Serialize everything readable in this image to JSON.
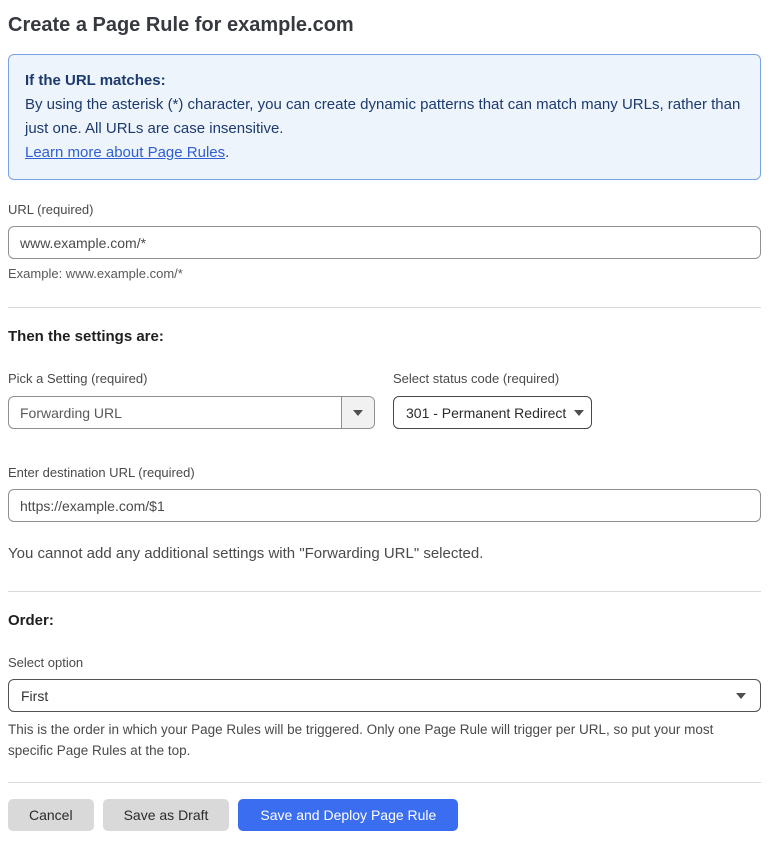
{
  "page_title": "Create a Page Rule for example.com",
  "info_box": {
    "heading": "If the URL matches:",
    "body": "By using the asterisk (*) character, you can create dynamic patterns that can match many URLs, rather than just one. All URLs are case insensitive.",
    "link_text": "Learn more about Page Rules",
    "link_suffix": "."
  },
  "url_field": {
    "label": "URL (required)",
    "value": "www.example.com/*",
    "help": "Example: www.example.com/*"
  },
  "settings_section": {
    "heading": "Then the settings are:",
    "setting_select": {
      "label": "Pick a Setting (required)",
      "value": "Forwarding URL"
    },
    "status_select": {
      "label": "Select status code (required)",
      "value": "301 - Permanent Redirect"
    },
    "destination_field": {
      "label": "Enter destination URL (required)",
      "value": "https://example.com/$1"
    },
    "note": "You cannot add any additional settings with \"Forwarding URL\" selected."
  },
  "order_section": {
    "heading": "Order:",
    "select_label": "Select option",
    "select_value": "First",
    "help": "This is the order in which your Page Rules will be triggered. Only one Page Rule will trigger per URL, so put your most specific Page Rules at the top."
  },
  "actions": {
    "cancel": "Cancel",
    "save_draft": "Save as Draft",
    "save_deploy": "Save and Deploy Page Rule"
  },
  "colors": {
    "accent_blue": "#3b6df1",
    "info_background": "#eef4fc",
    "info_border": "#7aa3e3",
    "info_text": "#1d3a6d",
    "link_blue": "#2f5fd0"
  }
}
